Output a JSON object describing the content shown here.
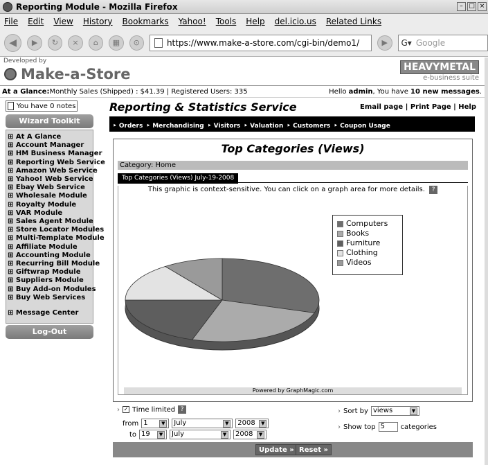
{
  "window": {
    "title": "Reporting Module - Mozilla Firefox"
  },
  "menubar": [
    "File",
    "Edit",
    "View",
    "History",
    "Bookmarks",
    "Yahoo!",
    "Tools",
    "Help",
    "del.icio.us",
    "Related Links"
  ],
  "toolbar": {
    "url": "https://www.make-a-store.com/cgi-bin/demo1/",
    "search_placeholder": "Google"
  },
  "header": {
    "developed_by": "Developed by",
    "logo": "Make-a-Store",
    "hm_title": "HEAVYMETAL",
    "hm_sub": "e-business suite"
  },
  "glance": {
    "label": "At a Glance:",
    "text": " Monthly Sales (Shipped) : $41.39 | Registered Users: 335",
    "hello": "Hello ",
    "user": "admin",
    "msg_prefix": ", You have ",
    "messages": "10 new messages",
    "msg_suffix": "."
  },
  "sidebar": {
    "notes": "You have 0 notes",
    "wizard": "Wizard Toolkit",
    "items": [
      "⊞ At A Glance",
      "⊞ Account Manager",
      "⊞ HM Business Manager",
      "⊞ Reporting Web Service",
      "⊞ Amazon Web Service",
      "⊞ Yahoo! Web Service",
      "⊞ Ebay Web Service",
      "⊞ Wholesale Module",
      "⊞ Royalty Module",
      "⊞ VAR Module",
      "⊞ Sales Agent Module",
      "⊞ Store Locator Modules",
      "⊞ Multi-Template Module",
      "⊞ Affiliate Module",
      "⊞ Accounting Module",
      "⊞ Recurring Bill Module",
      "⊞ Giftwrap Module",
      "⊞ Suppliers Module",
      "⊞ Buy Add-on Modules",
      "⊞ Buy Web Services"
    ],
    "message_center": "⊞ Message Center",
    "logout": "Log-Out"
  },
  "main": {
    "title": "Reporting & Statistics Service",
    "links": "Email page | Print Page | Help",
    "nav": [
      "‣ Orders",
      "‣ Merchandising",
      "‣ Visitors",
      "‣ Valuation",
      "‣ Customers",
      "‣ Coupon Usage"
    ],
    "report_title": "Top Categories (Views)",
    "category": "Category:  Home",
    "tab": "Top Categories (Views) July-19-2008",
    "context_note": "This graphic is context-sensitive. You can click on a graph area for more details.",
    "powered": "Powered by GraphMagic.com"
  },
  "chart_data": {
    "type": "pie",
    "categories": [
      "Computers",
      "Books",
      "Furniture",
      "Clothing",
      "Videos"
    ],
    "values": [
      30,
      25,
      20,
      15,
      10
    ],
    "colors": [
      "#6e6e6e",
      "#ababab",
      "#5e5e5e",
      "#e3e3e3",
      "#9a9a9a"
    ]
  },
  "controls": {
    "time_limited": "Time limited",
    "from": "from",
    "to": "to",
    "from_day": "1",
    "from_month": "July",
    "from_year": "2008",
    "to_day": "19",
    "to_month": "July",
    "to_year": "2008",
    "sort_by": "Sort by",
    "sort_value": "views",
    "show_top": "Show top",
    "top_value": "5",
    "categories": "categories",
    "update": "Update »",
    "reset": "Reset »"
  }
}
